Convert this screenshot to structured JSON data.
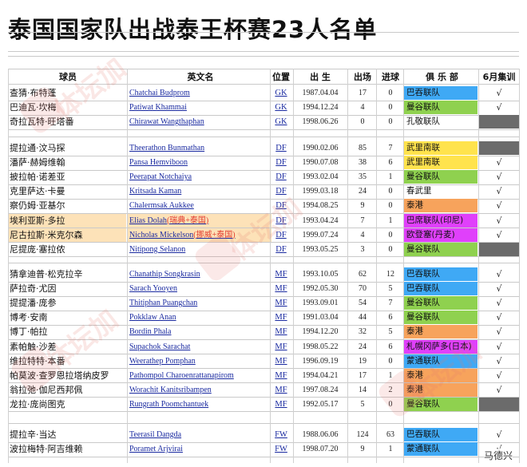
{
  "title": "泰国国家队出战泰王杯赛23人名单",
  "headers": {
    "cn": "球员",
    "en": "英文名",
    "pos": "位置",
    "dob": "出 生",
    "caps": "出场",
    "goals": "进球",
    "club": "俱 乐 部",
    "june": "6月集训"
  },
  "colors": {
    "blue": "#3fa9f5",
    "green": "#8fd14f",
    "yellow": "#ffe34d",
    "orange": "#f7a35c",
    "magenta": "#e040fb",
    "dark": "#6b6b6b",
    "peach": "#fde2b8"
  },
  "players": [
    {
      "cn": "查猜·布特蓬",
      "en": "Chatchai Budprom",
      "note": "",
      "pos": "GK",
      "dob": "1987.04.04",
      "caps": "17",
      "goals": "0",
      "club": "巴吞联队",
      "club_color": "blue",
      "june": "√",
      "june_dark": false,
      "highlight": false
    },
    {
      "cn": "巴迪瓦·坎梅",
      "en": "Patiwat Khammai",
      "note": "",
      "pos": "GK",
      "dob": "1994.12.24",
      "caps": "4",
      "goals": "0",
      "club": "曼谷联队",
      "club_color": "green",
      "june": "√",
      "june_dark": false,
      "highlight": false
    },
    {
      "cn": "奇拉瓦特·旺塔番",
      "en": "Chirawat Wangthaphan",
      "note": "",
      "pos": "GK",
      "dob": "1998.06.26",
      "caps": "0",
      "goals": "0",
      "club": "孔敬联队",
      "club_color": "",
      "june": "",
      "june_dark": true,
      "highlight": false
    },
    {
      "cn": "提拉通·汶马探",
      "en": "Theerathon Bunmathan",
      "note": "",
      "pos": "DF",
      "dob": "1990.02.06",
      "caps": "85",
      "goals": "7",
      "club": "武里南联",
      "club_color": "yellow",
      "june": "",
      "june_dark": true,
      "highlight": false
    },
    {
      "cn": "潘萨·赫姆维翰",
      "en": "Pansa Hemviboon",
      "note": "",
      "pos": "DF",
      "dob": "1990.07.08",
      "caps": "38",
      "goals": "6",
      "club": "武里南联",
      "club_color": "yellow",
      "june": "√",
      "june_dark": false,
      "highlight": false
    },
    {
      "cn": "披拉帕·诺差亚",
      "en": "Peerapat Notchaiya",
      "note": "",
      "pos": "DF",
      "dob": "1993.02.04",
      "caps": "35",
      "goals": "1",
      "club": "曼谷联队",
      "club_color": "green",
      "june": "√",
      "june_dark": false,
      "highlight": false
    },
    {
      "cn": "克里萨达·卡曼",
      "en": "Kritsada Kaman",
      "note": "",
      "pos": "DF",
      "dob": "1999.03.18",
      "caps": "24",
      "goals": "0",
      "club": "春武里",
      "club_color": "",
      "june": "√",
      "june_dark": false,
      "highlight": false
    },
    {
      "cn": "察仍姆·亚基尔",
      "en": "Chalermsak Aukkee",
      "note": "",
      "pos": "DF",
      "dob": "1994.08.25",
      "caps": "9",
      "goals": "0",
      "club": "泰港",
      "club_color": "orange",
      "june": "√",
      "june_dark": false,
      "highlight": false
    },
    {
      "cn": "埃利亚斯·多拉",
      "en": "Elias Dolah",
      "note": "(瑞典+泰国)",
      "pos": "DF",
      "dob": "1993.04.24",
      "caps": "7",
      "goals": "1",
      "club": "巴席联队(印尼)",
      "club_color": "magenta",
      "june": "√",
      "june_dark": false,
      "highlight": true
    },
    {
      "cn": "尼古拉斯·米克尔森",
      "en": "Nicholas Mickelson",
      "note": "(挪威+泰国)",
      "pos": "DF",
      "dob": "1999.07.24",
      "caps": "4",
      "goals": "0",
      "club": "欧登塞(丹麦)",
      "club_color": "magenta",
      "june": "√",
      "june_dark": false,
      "highlight": true
    },
    {
      "cn": "尼提庞·塞拉侬",
      "en": "Nitipong Selanon",
      "note": "",
      "pos": "DF",
      "dob": "1993.05.25",
      "caps": "3",
      "goals": "0",
      "club": "曼谷联队",
      "club_color": "green",
      "june": "",
      "june_dark": true,
      "highlight": false
    },
    {
      "cn": "猜拿迪普·松克拉辛",
      "en": "Chanathip Songkrasin",
      "note": "",
      "pos": "MF",
      "dob": "1993.10.05",
      "caps": "62",
      "goals": "12",
      "club": "巴吞联队",
      "club_color": "blue",
      "june": "√",
      "june_dark": false,
      "highlight": false
    },
    {
      "cn": "萨拉奇·尤因",
      "en": "Sarach Yooyen",
      "note": "",
      "pos": "MF",
      "dob": "1992.05.30",
      "caps": "70",
      "goals": "5",
      "club": "巴吞联队",
      "club_color": "blue",
      "june": "√",
      "june_dark": false,
      "highlight": false
    },
    {
      "cn": "提提潘·庞参",
      "en": "Thitiphan Puangchan",
      "note": "",
      "pos": "MF",
      "dob": "1993.09.01",
      "caps": "54",
      "goals": "7",
      "club": "曼谷联队",
      "club_color": "green",
      "june": "√",
      "june_dark": false,
      "highlight": false
    },
    {
      "cn": "博考·安南",
      "en": "Pokklaw Anan",
      "note": "",
      "pos": "MF",
      "dob": "1991.03.04",
      "caps": "44",
      "goals": "6",
      "club": "曼谷联队",
      "club_color": "green",
      "june": "√",
      "june_dark": false,
      "highlight": false
    },
    {
      "cn": "博丁·帕拉",
      "en": "Bordin Phala",
      "note": "",
      "pos": "MF",
      "dob": "1994.12.20",
      "caps": "32",
      "goals": "5",
      "club": "泰港",
      "club_color": "orange",
      "june": "√",
      "june_dark": false,
      "highlight": false
    },
    {
      "cn": "素帕触·沙差",
      "en": "Supachok Sarachat",
      "note": "",
      "pos": "MF",
      "dob": "1998.05.22",
      "caps": "24",
      "goals": "6",
      "club": "札幌冈萨多(日本)",
      "club_color": "magenta",
      "june": "√",
      "june_dark": false,
      "highlight": false
    },
    {
      "cn": "维拉特特·本番",
      "en": "Weerathep Pomphan",
      "note": "",
      "pos": "MF",
      "dob": "1996.09.19",
      "caps": "19",
      "goals": "0",
      "club": "蒙通联队",
      "club_color": "blue",
      "june": "√",
      "june_dark": false,
      "highlight": false
    },
    {
      "cn": "帕莫波·查罗恩拉塔纳皮罗",
      "en": "Pathompol Charoenrattanapirom",
      "note": "",
      "pos": "MF",
      "dob": "1994.04.21",
      "caps": "17",
      "goals": "1",
      "club": "泰港",
      "club_color": "orange",
      "june": "√",
      "june_dark": false,
      "highlight": false
    },
    {
      "cn": "翁拉弛·伽尼西邦佩",
      "en": "Worachit Kanitsribampen",
      "note": "",
      "pos": "MF",
      "dob": "1997.08.24",
      "caps": "14",
      "goals": "2",
      "club": "泰港",
      "club_color": "orange",
      "june": "√",
      "june_dark": false,
      "highlight": false
    },
    {
      "cn": "龙拉·庞尚图克",
      "en": "Rungrath Poomchantuek",
      "note": "",
      "pos": "MF",
      "dob": "1992.05.17",
      "caps": "5",
      "goals": "0",
      "club": "曼谷联队",
      "club_color": "green",
      "june": "",
      "june_dark": true,
      "highlight": false
    },
    {
      "cn": "提拉辛·当达",
      "en": "Teerasil Dangda",
      "note": "",
      "pos": "FW",
      "dob": "1988.06.06",
      "caps": "124",
      "goals": "63",
      "club": "巴吞联队",
      "club_color": "blue",
      "june": "√",
      "june_dark": false,
      "highlight": false
    },
    {
      "cn": "波拉梅特·阿吉维赖",
      "en": "Poramet Arjvirai",
      "note": "",
      "pos": "FW",
      "dob": "1998.07.20",
      "caps": "9",
      "goals": "1",
      "club": "蒙通联队",
      "club_color": "blue",
      "june": "√",
      "june_dark": false,
      "highlight": false
    }
  ],
  "watermark": {
    "text1": "体坛加",
    "text2": "体坛加",
    "text3": "体坛加",
    "text4": "体坛加"
  },
  "credit": "马德兴"
}
